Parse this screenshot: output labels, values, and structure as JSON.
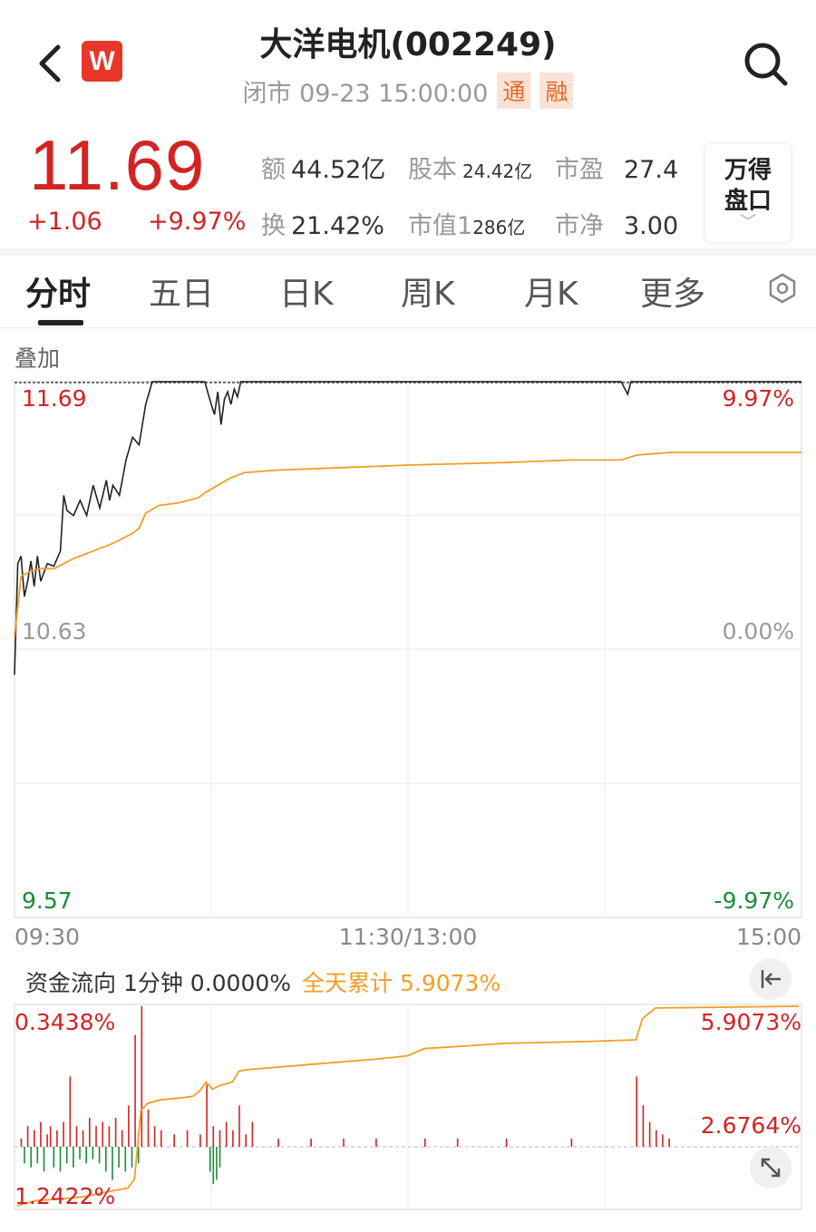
{
  "header": {
    "title": "大洋电机(002249)",
    "status": "闭市 09-23 15:00:00",
    "tags": [
      "通",
      "融"
    ],
    "logo_letter": "W"
  },
  "quote": {
    "price": "11.69",
    "change": "+1.06",
    "change_pct": "+9.97%",
    "stats": {
      "amount_label": "额",
      "amount": "44.52亿",
      "shares_label": "股本",
      "shares": "24.42亿",
      "pe_label": "市盈",
      "pe": "27.4",
      "turnover_label": "换",
      "turnover": "21.42%",
      "mcap_label": "市值",
      "mcap_a": "1",
      "mcap_b": "286亿",
      "pb_label": "市净",
      "pb": "3.00"
    },
    "wind_panel": "万得\n盘口",
    "wind_l1": "万得",
    "wind_l2": "盘口"
  },
  "tabs": [
    {
      "label": "分时",
      "active": true
    },
    {
      "label": "五日"
    },
    {
      "label": "日K"
    },
    {
      "label": "周K"
    },
    {
      "label": "月K"
    },
    {
      "label": "更多"
    }
  ],
  "overlay_label": "叠加",
  "colors": {
    "up": "#d32323",
    "down": "#1a8c3a",
    "avg": "#f0a024",
    "price": "#222222"
  },
  "chart_data": [
    {
      "type": "line",
      "price_axis": {
        "top": "11.69",
        "mid": "10.63",
        "bottom": "9.57"
      },
      "pct_axis": {
        "top": "9.97%",
        "mid": "0.00%",
        "bottom": "-9.97%"
      },
      "time_labels": [
        "09:30",
        "11:30/13:00",
        "15:00"
      ],
      "ylim": [
        9.57,
        11.69
      ],
      "x_minutes_total": 240,
      "series": [
        {
          "name": "price",
          "points": [
            [
              0,
              10.53
            ],
            [
              1,
              10.97
            ],
            [
              2,
              11.0
            ],
            [
              3,
              10.84
            ],
            [
              4,
              10.9
            ],
            [
              5,
              10.98
            ],
            [
              6,
              10.88
            ],
            [
              7,
              11.0
            ],
            [
              8,
              10.9
            ],
            [
              10,
              10.97
            ],
            [
              12,
              10.96
            ],
            [
              14,
              11.02
            ],
            [
              15,
              11.24
            ],
            [
              16,
              11.18
            ],
            [
              18,
              11.16
            ],
            [
              20,
              11.22
            ],
            [
              22,
              11.16
            ],
            [
              24,
              11.28
            ],
            [
              26,
              11.19
            ],
            [
              28,
              11.3
            ],
            [
              29,
              11.22
            ],
            [
              30,
              11.28
            ],
            [
              32,
              11.24
            ],
            [
              34,
              11.38
            ],
            [
              36,
              11.47
            ],
            [
              38,
              11.44
            ],
            [
              40,
              11.6
            ],
            [
              42,
              11.69
            ],
            [
              45,
              11.69
            ],
            [
              50,
              11.69
            ],
            [
              55,
              11.69
            ],
            [
              58,
              11.69
            ],
            [
              60,
              11.6
            ],
            [
              61,
              11.56
            ],
            [
              62,
              11.65
            ],
            [
              63,
              11.52
            ],
            [
              64,
              11.62
            ],
            [
              65,
              11.65
            ],
            [
              66,
              11.6
            ],
            [
              67,
              11.66
            ],
            [
              68,
              11.63
            ],
            [
              69,
              11.69
            ],
            [
              80,
              11.69
            ],
            [
              100,
              11.69
            ],
            [
              120,
              11.69
            ],
            [
              150,
              11.69
            ],
            [
              170,
              11.69
            ],
            [
              185,
              11.69
            ],
            [
              187,
              11.64
            ],
            [
              188,
              11.69
            ],
            [
              200,
              11.69
            ],
            [
              240,
              11.69
            ]
          ]
        },
        {
          "name": "avg",
          "points": [
            [
              0,
              10.68
            ],
            [
              2,
              10.92
            ],
            [
              5,
              10.94
            ],
            [
              8,
              10.95
            ],
            [
              12,
              10.95
            ],
            [
              18,
              10.99
            ],
            [
              24,
              11.02
            ],
            [
              30,
              11.05
            ],
            [
              36,
              11.09
            ],
            [
              38,
              11.11
            ],
            [
              40,
              11.17
            ],
            [
              44,
              11.2
            ],
            [
              50,
              11.21
            ],
            [
              56,
              11.23
            ],
            [
              58,
              11.25
            ],
            [
              62,
              11.28
            ],
            [
              66,
              11.31
            ],
            [
              70,
              11.33
            ],
            [
              80,
              11.34
            ],
            [
              100,
              11.35
            ],
            [
              120,
              11.36
            ],
            [
              150,
              11.37
            ],
            [
              170,
              11.38
            ],
            [
              185,
              11.38
            ],
            [
              190,
              11.4
            ],
            [
              200,
              11.41
            ],
            [
              240,
              11.41
            ]
          ]
        }
      ]
    },
    {
      "type": "bar",
      "title": "资金流向",
      "header_text": "资金流向 1分钟 0.0000%",
      "cumulative_text": "全天累计 5.9073%",
      "axis": {
        "top": "0.3438%",
        "right_top": "5.9073%",
        "right_mid": "2.6764%",
        "left_bottom": "1.2422%"
      },
      "note": "1-minute net inflow bars plus cumulative line",
      "cumulative": [
        [
          0,
          -1.3
        ],
        [
          6,
          -1.15
        ],
        [
          12,
          -1.12
        ],
        [
          20,
          -1.05
        ],
        [
          28,
          -0.9
        ],
        [
          34,
          -0.8
        ],
        [
          36,
          -0.55
        ],
        [
          38,
          1.4
        ],
        [
          40,
          1.6
        ],
        [
          44,
          1.7
        ],
        [
          50,
          1.75
        ],
        [
          54,
          1.8
        ],
        [
          56,
          1.95
        ],
        [
          58,
          2.2
        ],
        [
          60,
          2.0
        ],
        [
          62,
          2.1
        ],
        [
          66,
          2.2
        ],
        [
          68,
          2.5
        ],
        [
          70,
          2.55
        ],
        [
          90,
          2.7
        ],
        [
          110,
          2.85
        ],
        [
          120,
          2.95
        ],
        [
          125,
          3.15
        ],
        [
          150,
          3.3
        ],
        [
          175,
          3.35
        ],
        [
          190,
          3.4
        ],
        [
          192,
          4.0
        ],
        [
          196,
          4.3
        ],
        [
          240,
          4.35
        ]
      ],
      "bars": [
        [
          1,
          0.02
        ],
        [
          3,
          0.05
        ],
        [
          5,
          0.04
        ],
        [
          7,
          0.06
        ],
        [
          9,
          0.03
        ],
        [
          10,
          0.05
        ],
        [
          12,
          0.04
        ],
        [
          14,
          0.06
        ],
        [
          16,
          0.17
        ],
        [
          18,
          0.05
        ],
        [
          20,
          0.04
        ],
        [
          22,
          0.07
        ],
        [
          24,
          0.05
        ],
        [
          26,
          0.06
        ],
        [
          28,
          0.05
        ],
        [
          30,
          0.07
        ],
        [
          32,
          0.04
        ],
        [
          34,
          0.1
        ],
        [
          36,
          0.27
        ],
        [
          38,
          0.34
        ],
        [
          40,
          0.09
        ],
        [
          42,
          0.05
        ],
        [
          44,
          0.04
        ],
        [
          48,
          0.03
        ],
        [
          52,
          0.04
        ],
        [
          56,
          0.03
        ],
        [
          58,
          0.15
        ],
        [
          60,
          0.05
        ],
        [
          62,
          0.04
        ],
        [
          64,
          0.06
        ],
        [
          66,
          0.04
        ],
        [
          68,
          0.1
        ],
        [
          70,
          0.03
        ],
        [
          72,
          0.06
        ],
        [
          80,
          0.02
        ],
        [
          90,
          0.02
        ],
        [
          100,
          0.02
        ],
        [
          110,
          0.02
        ],
        [
          125,
          0.02
        ],
        [
          135,
          0.02
        ],
        [
          150,
          0.02
        ],
        [
          170,
          0.02
        ],
        [
          190,
          0.17
        ],
        [
          192,
          0.1
        ],
        [
          194,
          0.06
        ],
        [
          196,
          0.04
        ],
        [
          198,
          0.03
        ],
        [
          200,
          0.02
        ]
      ],
      "neg_bars": [
        [
          2,
          -0.04
        ],
        [
          4,
          -0.05
        ],
        [
          6,
          -0.04
        ],
        [
          8,
          -0.06
        ],
        [
          11,
          -0.05
        ],
        [
          13,
          -0.06
        ],
        [
          15,
          -0.04
        ],
        [
          17,
          -0.05
        ],
        [
          19,
          -0.03
        ],
        [
          21,
          -0.04
        ],
        [
          23,
          -0.03
        ],
        [
          25,
          -0.04
        ],
        [
          27,
          -0.06
        ],
        [
          29,
          -0.08
        ],
        [
          31,
          -0.05
        ],
        [
          33,
          -0.06
        ],
        [
          35,
          -0.05
        ],
        [
          37,
          -0.04
        ],
        [
          59,
          -0.06
        ],
        [
          60,
          -0.09
        ],
        [
          61,
          -0.08
        ],
        [
          62,
          -0.05
        ]
      ]
    }
  ]
}
